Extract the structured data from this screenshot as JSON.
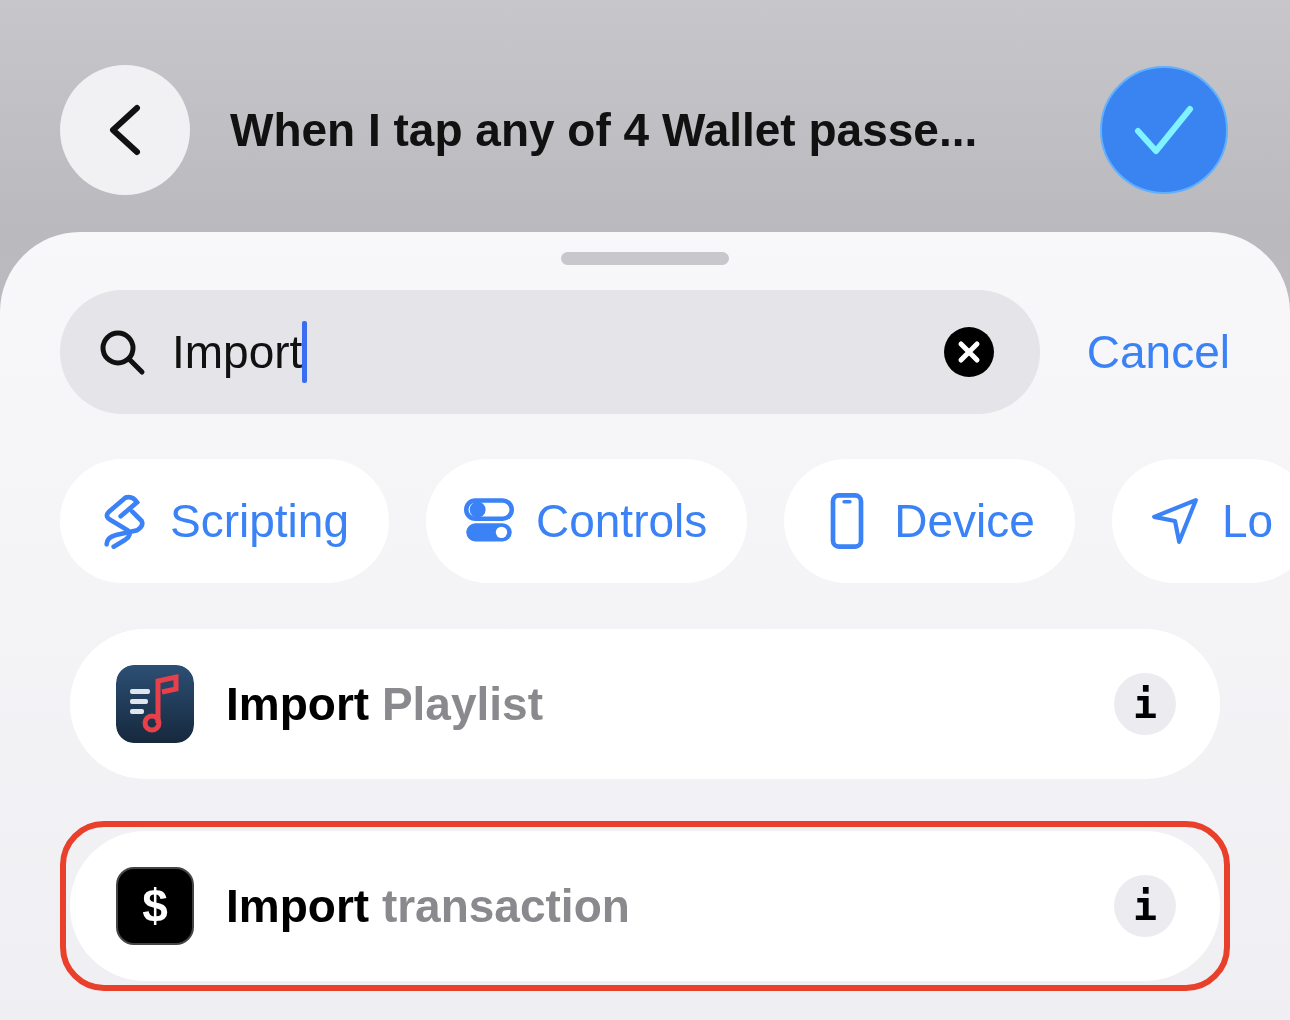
{
  "header": {
    "title": "When I tap any of 4 Wallet passe...",
    "done_selected": true
  },
  "search": {
    "value": "Import",
    "cancel": "Cancel"
  },
  "chips": [
    {
      "kind": "scripting",
      "label": "Scripting"
    },
    {
      "kind": "controls",
      "label": "Controls"
    },
    {
      "kind": "device",
      "label": "Device"
    },
    {
      "kind": "location",
      "label": "Lo"
    }
  ],
  "results": [
    {
      "kind": "playlist",
      "title": "**Import** Playlist",
      "info": "i",
      "highlighted": false
    },
    {
      "kind": "money",
      "glyph": "$",
      "title": "**Import** transaction",
      "info": "i",
      "highlighted": true
    }
  ]
}
